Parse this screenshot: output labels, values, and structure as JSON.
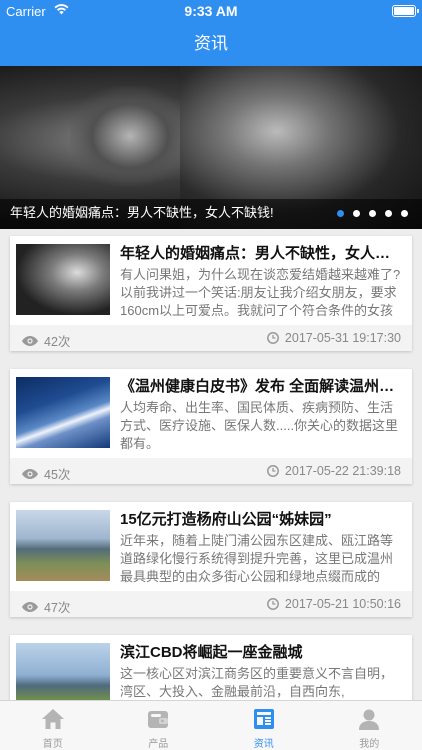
{
  "status_bar": {
    "carrier": "Carrier",
    "time": "9:33 AM"
  },
  "header": {
    "title": "资讯"
  },
  "banner": {
    "caption": "年轻人的婚姻痛点：男人不缺性，女人不缺钱!",
    "slide_count": 5,
    "active_slide": 1
  },
  "articles": [
    {
      "title": "年轻人的婚姻痛点：男人不缺性，女人不缺钱!",
      "summary": "有人问果姐，为什么现在谈恋爱结婚越来越难了?以前我讲过一个笑话:朋友让我介绍女朋友，要求160cm以上可爱点。我就问了个符合条件的女孩",
      "views": "42次",
      "date": "2017-05-31 19:17:30"
    },
    {
      "title": "《温州健康白皮书》发布 全面解读温州市民健康状况",
      "summary": "人均寿命、出生率、国民体质、疾病预防、生活方式、医疗设施、医保人数.....你关心的数据这里都有。",
      "views": "45次",
      "date": "2017-05-22 21:39:18"
    },
    {
      "title": "15亿元打造杨府山公园“姊妹园”",
      "summary": "近年来，随着上陡门浦公园东区建成、瓯江路等道路绿化慢行系统得到提升完善，这里已成温州最具典型的由众多街心公园和绿地点缀而成的",
      "views": "47次",
      "date": "2017-05-21 10:50:16"
    },
    {
      "title": "滨江CBD将崛起一座金融城",
      "summary": "这一核心区对滨江商务区的重要意义不言自明，湾区、大投入、金融最前沿，自西向东,",
      "views": "",
      "date": ""
    }
  ],
  "tabbar": {
    "items": [
      {
        "label": "首页",
        "icon": "home-icon"
      },
      {
        "label": "产品",
        "icon": "product-icon"
      },
      {
        "label": "资讯",
        "icon": "news-icon"
      },
      {
        "label": "我的",
        "icon": "profile-icon"
      }
    ],
    "active": "资讯"
  },
  "colors": {
    "accent": "#2f8ff0",
    "background": "#ededed",
    "inactive_tab": "#9b9b9b"
  }
}
